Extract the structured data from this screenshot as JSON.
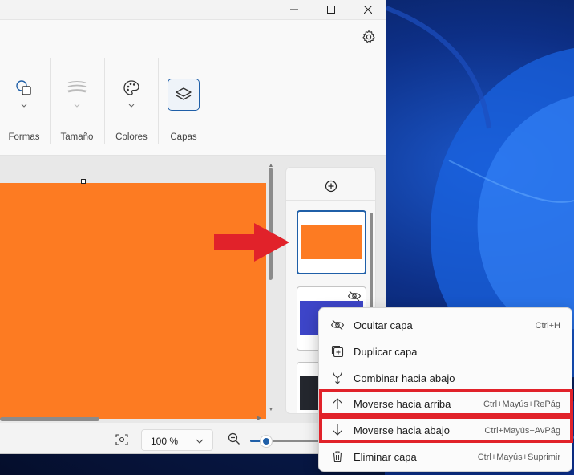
{
  "ribbon": {
    "groups": [
      {
        "label": "Formas",
        "icon": "shapes-icon"
      },
      {
        "label": "Tamaño",
        "icon": "brush-size-icon"
      },
      {
        "label": "Colores",
        "icon": "palette-icon"
      },
      {
        "label": "Capas",
        "icon": "layers-icon"
      }
    ]
  },
  "statusbar": {
    "zoom_value": "100 %",
    "zoom_slider_fraction": 0.13
  },
  "layers_panel": {
    "layers": [
      {
        "color": "#fd7b22",
        "selected": true
      },
      {
        "color": "#3d45c8",
        "hidden": true
      },
      {
        "color": "#24272e"
      }
    ]
  },
  "context_menu": {
    "items": [
      {
        "label": "Ocultar capa",
        "shortcut": "Ctrl+H",
        "icon": "eye-hidden-icon"
      },
      {
        "label": "Duplicar capa",
        "shortcut": "",
        "icon": "duplicate-icon"
      },
      {
        "label": "Combinar hacia abajo",
        "shortcut": "",
        "icon": "merge-down-icon"
      },
      {
        "label": "Moverse hacia arriba",
        "shortcut": "Ctrl+Mayús+RePág",
        "icon": "arrow-up-icon"
      },
      {
        "label": "Moverse hacia abajo",
        "shortcut": "Ctrl+Mayús+AvPág",
        "icon": "arrow-down-icon"
      },
      {
        "label": "Eliminar capa",
        "shortcut": "Ctrl+Mayús+Suprimir",
        "icon": "trash-icon"
      }
    ]
  },
  "colors": {
    "canvas": "#fd7b22",
    "accent": "#1f5fa8",
    "highlight": "#e1222a"
  }
}
